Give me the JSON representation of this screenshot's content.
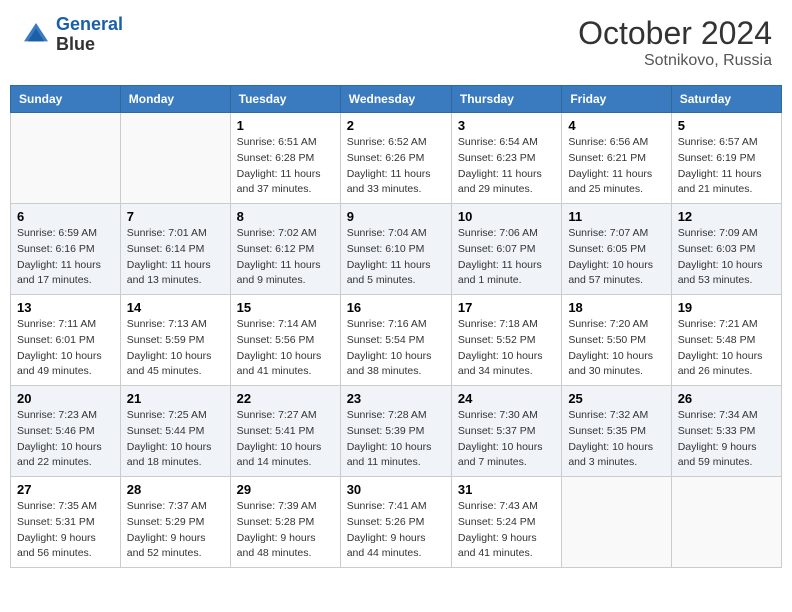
{
  "header": {
    "logo_line1": "General",
    "logo_line2": "Blue",
    "month_year": "October 2024",
    "location": "Sotnikovo, Russia"
  },
  "weekdays": [
    "Sunday",
    "Monday",
    "Tuesday",
    "Wednesday",
    "Thursday",
    "Friday",
    "Saturday"
  ],
  "weeks": [
    [
      {
        "day": "",
        "sunrise": "",
        "sunset": "",
        "daylight": ""
      },
      {
        "day": "",
        "sunrise": "",
        "sunset": "",
        "daylight": ""
      },
      {
        "day": "1",
        "sunrise": "Sunrise: 6:51 AM",
        "sunset": "Sunset: 6:28 PM",
        "daylight": "Daylight: 11 hours and 37 minutes."
      },
      {
        "day": "2",
        "sunrise": "Sunrise: 6:52 AM",
        "sunset": "Sunset: 6:26 PM",
        "daylight": "Daylight: 11 hours and 33 minutes."
      },
      {
        "day": "3",
        "sunrise": "Sunrise: 6:54 AM",
        "sunset": "Sunset: 6:23 PM",
        "daylight": "Daylight: 11 hours and 29 minutes."
      },
      {
        "day": "4",
        "sunrise": "Sunrise: 6:56 AM",
        "sunset": "Sunset: 6:21 PM",
        "daylight": "Daylight: 11 hours and 25 minutes."
      },
      {
        "day": "5",
        "sunrise": "Sunrise: 6:57 AM",
        "sunset": "Sunset: 6:19 PM",
        "daylight": "Daylight: 11 hours and 21 minutes."
      }
    ],
    [
      {
        "day": "6",
        "sunrise": "Sunrise: 6:59 AM",
        "sunset": "Sunset: 6:16 PM",
        "daylight": "Daylight: 11 hours and 17 minutes."
      },
      {
        "day": "7",
        "sunrise": "Sunrise: 7:01 AM",
        "sunset": "Sunset: 6:14 PM",
        "daylight": "Daylight: 11 hours and 13 minutes."
      },
      {
        "day": "8",
        "sunrise": "Sunrise: 7:02 AM",
        "sunset": "Sunset: 6:12 PM",
        "daylight": "Daylight: 11 hours and 9 minutes."
      },
      {
        "day": "9",
        "sunrise": "Sunrise: 7:04 AM",
        "sunset": "Sunset: 6:10 PM",
        "daylight": "Daylight: 11 hours and 5 minutes."
      },
      {
        "day": "10",
        "sunrise": "Sunrise: 7:06 AM",
        "sunset": "Sunset: 6:07 PM",
        "daylight": "Daylight: 11 hours and 1 minute."
      },
      {
        "day": "11",
        "sunrise": "Sunrise: 7:07 AM",
        "sunset": "Sunset: 6:05 PM",
        "daylight": "Daylight: 10 hours and 57 minutes."
      },
      {
        "day": "12",
        "sunrise": "Sunrise: 7:09 AM",
        "sunset": "Sunset: 6:03 PM",
        "daylight": "Daylight: 10 hours and 53 minutes."
      }
    ],
    [
      {
        "day": "13",
        "sunrise": "Sunrise: 7:11 AM",
        "sunset": "Sunset: 6:01 PM",
        "daylight": "Daylight: 10 hours and 49 minutes."
      },
      {
        "day": "14",
        "sunrise": "Sunrise: 7:13 AM",
        "sunset": "Sunset: 5:59 PM",
        "daylight": "Daylight: 10 hours and 45 minutes."
      },
      {
        "day": "15",
        "sunrise": "Sunrise: 7:14 AM",
        "sunset": "Sunset: 5:56 PM",
        "daylight": "Daylight: 10 hours and 41 minutes."
      },
      {
        "day": "16",
        "sunrise": "Sunrise: 7:16 AM",
        "sunset": "Sunset: 5:54 PM",
        "daylight": "Daylight: 10 hours and 38 minutes."
      },
      {
        "day": "17",
        "sunrise": "Sunrise: 7:18 AM",
        "sunset": "Sunset: 5:52 PM",
        "daylight": "Daylight: 10 hours and 34 minutes."
      },
      {
        "day": "18",
        "sunrise": "Sunrise: 7:20 AM",
        "sunset": "Sunset: 5:50 PM",
        "daylight": "Daylight: 10 hours and 30 minutes."
      },
      {
        "day": "19",
        "sunrise": "Sunrise: 7:21 AM",
        "sunset": "Sunset: 5:48 PM",
        "daylight": "Daylight: 10 hours and 26 minutes."
      }
    ],
    [
      {
        "day": "20",
        "sunrise": "Sunrise: 7:23 AM",
        "sunset": "Sunset: 5:46 PM",
        "daylight": "Daylight: 10 hours and 22 minutes."
      },
      {
        "day": "21",
        "sunrise": "Sunrise: 7:25 AM",
        "sunset": "Sunset: 5:44 PM",
        "daylight": "Daylight: 10 hours and 18 minutes."
      },
      {
        "day": "22",
        "sunrise": "Sunrise: 7:27 AM",
        "sunset": "Sunset: 5:41 PM",
        "daylight": "Daylight: 10 hours and 14 minutes."
      },
      {
        "day": "23",
        "sunrise": "Sunrise: 7:28 AM",
        "sunset": "Sunset: 5:39 PM",
        "daylight": "Daylight: 10 hours and 11 minutes."
      },
      {
        "day": "24",
        "sunrise": "Sunrise: 7:30 AM",
        "sunset": "Sunset: 5:37 PM",
        "daylight": "Daylight: 10 hours and 7 minutes."
      },
      {
        "day": "25",
        "sunrise": "Sunrise: 7:32 AM",
        "sunset": "Sunset: 5:35 PM",
        "daylight": "Daylight: 10 hours and 3 minutes."
      },
      {
        "day": "26",
        "sunrise": "Sunrise: 7:34 AM",
        "sunset": "Sunset: 5:33 PM",
        "daylight": "Daylight: 9 hours and 59 minutes."
      }
    ],
    [
      {
        "day": "27",
        "sunrise": "Sunrise: 7:35 AM",
        "sunset": "Sunset: 5:31 PM",
        "daylight": "Daylight: 9 hours and 56 minutes."
      },
      {
        "day": "28",
        "sunrise": "Sunrise: 7:37 AM",
        "sunset": "Sunset: 5:29 PM",
        "daylight": "Daylight: 9 hours and 52 minutes."
      },
      {
        "day": "29",
        "sunrise": "Sunrise: 7:39 AM",
        "sunset": "Sunset: 5:28 PM",
        "daylight": "Daylight: 9 hours and 48 minutes."
      },
      {
        "day": "30",
        "sunrise": "Sunrise: 7:41 AM",
        "sunset": "Sunset: 5:26 PM",
        "daylight": "Daylight: 9 hours and 44 minutes."
      },
      {
        "day": "31",
        "sunrise": "Sunrise: 7:43 AM",
        "sunset": "Sunset: 5:24 PM",
        "daylight": "Daylight: 9 hours and 41 minutes."
      },
      {
        "day": "",
        "sunrise": "",
        "sunset": "",
        "daylight": ""
      },
      {
        "day": "",
        "sunrise": "",
        "sunset": "",
        "daylight": ""
      }
    ]
  ]
}
